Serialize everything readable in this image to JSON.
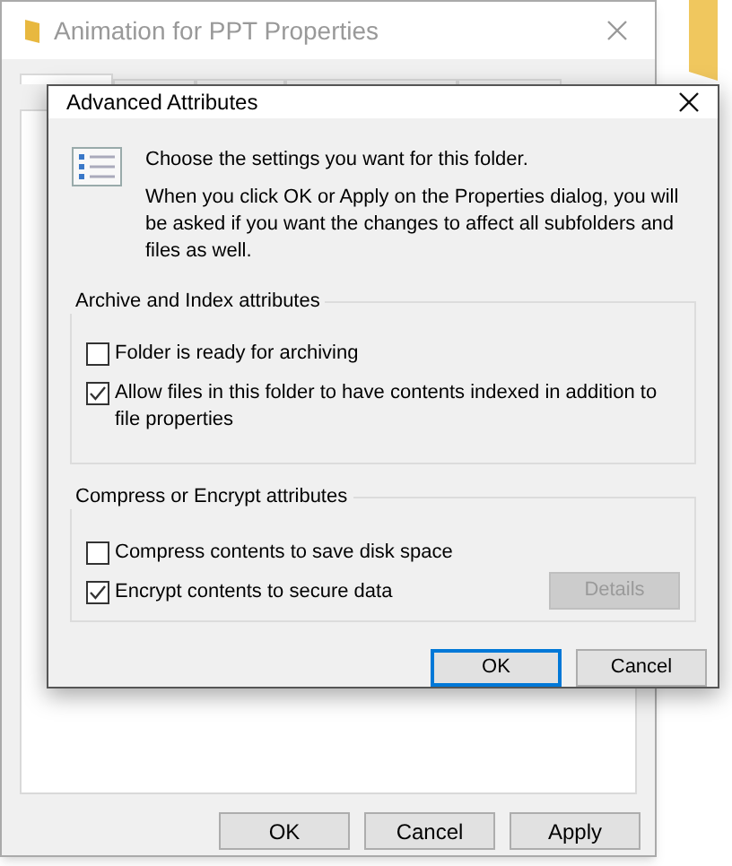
{
  "back_window": {
    "title": "Animation for PPT Properties",
    "active": false,
    "tabs": [
      {
        "selected": true
      },
      {
        "selected": false
      },
      {
        "selected": false
      },
      {
        "selected": false
      },
      {
        "selected": false
      }
    ],
    "buttons": [
      {
        "label": "OK",
        "disabled": false
      },
      {
        "label": "Cancel",
        "disabled": false
      },
      {
        "label": "Apply",
        "disabled": false
      }
    ]
  },
  "dialog": {
    "title": "Advanced Attributes",
    "active": true,
    "intro": "Choose the settings you want for this folder.",
    "note": "When you click OK or Apply on the Properties dialog, you will be asked if you want the changes to affect all subfolders and files as well.",
    "groups": [
      {
        "title": "Archive and Index attributes",
        "options": [
          {
            "label": "Folder is ready for archiving",
            "checked": false
          },
          {
            "label": "Allow files in this folder to have contents indexed in addition to file properties",
            "checked": true
          }
        ]
      },
      {
        "title": "Compress or Encrypt attributes",
        "options": [
          {
            "label": "Compress contents to save disk space",
            "checked": false
          },
          {
            "label": "Encrypt contents to secure data",
            "checked": true
          }
        ],
        "button": {
          "label": "Details",
          "disabled": true
        }
      }
    ],
    "buttons": [
      {
        "label": "OK",
        "default": true
      },
      {
        "label": "Cancel",
        "default": false
      }
    ]
  }
}
